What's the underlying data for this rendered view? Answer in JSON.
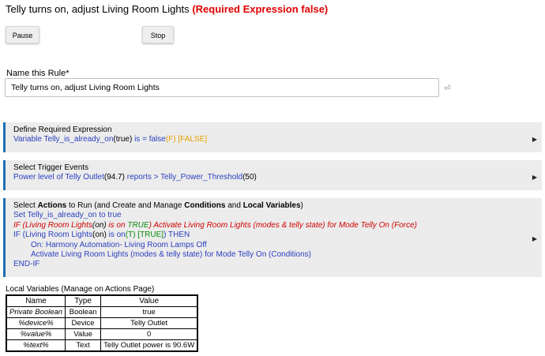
{
  "rule_title": {
    "text": "Telly turns on, adjust Living Room Lights",
    "warning": "(Required Expression false)"
  },
  "buttons": {
    "pause": "Pause",
    "stop": "Stop"
  },
  "name_field": {
    "label": "Name this Rule*",
    "value": "Telly turns on, adjust Living Room Lights"
  },
  "required_expression": {
    "header": "Define Required Expression",
    "p1": "Variable Telly_is_already_on",
    "p2": "(true)",
    "p3": " is = false",
    "p4": "(F)",
    "p5": " [FALSE]"
  },
  "trigger": {
    "header": "Select Trigger Events",
    "p1": "Power level of Telly Outlet",
    "p2": "(94.7)",
    "p3": " reports > Telly_Power_Threshold",
    "p4": "(50)"
  },
  "actions": {
    "header_a": "Select ",
    "header_b": "Actions",
    "header_c": " to Run (and Create and Manage ",
    "header_d": "Conditions",
    "header_e": " and ",
    "header_f": "Local Variables",
    "header_g": ")",
    "line1": "Set Telly_is_already_on to true",
    "line2_a": "IF (Living Room Lights",
    "line2_b": "(on)",
    "line2_c": " is on ",
    "line2_d": "TRUE",
    "line2_e": ") Activate Living Room Lights (modes & telly state) for Mode Telly On (Force)",
    "line3_a": "IF (Living Room Lights",
    "line3_b": "(on)",
    "line3_c": " is on",
    "line3_d": "(T) [TRUE]",
    "line3_e": ") THEN",
    "line4": "On: Harmony Automation- Living Room Lamps Off",
    "line5": "Activate Living Room Lights (modes & telly state) for Mode Telly On (Conditions)",
    "line6": "END-IF"
  },
  "local_variables": {
    "title": "Local Variables",
    "title_suffix": " (Manage on Actions Page)",
    "columns": [
      "Name",
      "Type",
      "Value"
    ],
    "rows": [
      [
        "Private Boolean",
        "Boolean",
        "true"
      ],
      [
        "%device%",
        "Device",
        "Telly Outlet"
      ],
      [
        "%value%",
        "Value",
        "0"
      ],
      [
        "%text%",
        "Text",
        "Telly Outlet power is 90.6W"
      ]
    ]
  },
  "icons": {
    "expand": "triangle-right-icon",
    "return": "return-arrow-icon"
  },
  "colors": {
    "accent_bar": "#1f6fb2",
    "blue_text": "#2a3fbf",
    "green_text": "#0a8a0a",
    "orange_text": "#e8a000",
    "red_text": "#d00000"
  }
}
